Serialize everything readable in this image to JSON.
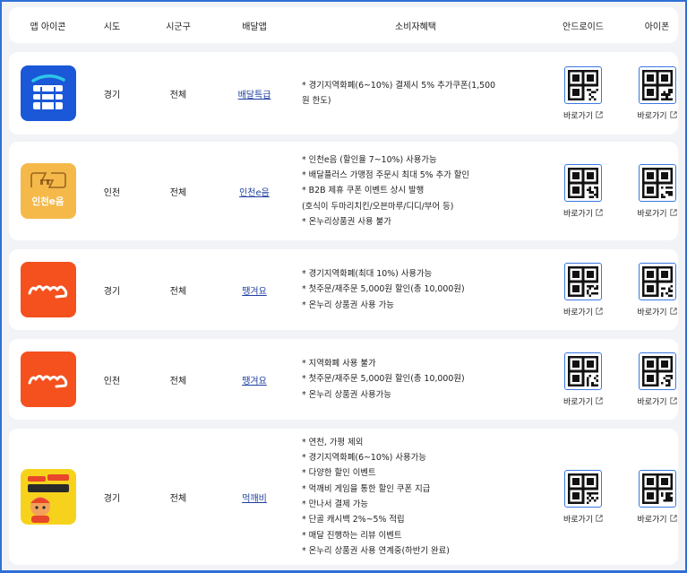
{
  "header": {
    "col_icon": "앱 아이콘",
    "col_sido": "시도",
    "col_sigungu": "시군구",
    "col_app": "배달앱",
    "col_benefit": "소비자혜택",
    "col_android": "안드로이드",
    "col_iphone": "아이폰"
  },
  "colors": {
    "accent": "#2f6fd6",
    "link": "#1f3f9f"
  },
  "rows": [
    {
      "icon": "baedal-teukgeup-app-icon",
      "sido": "경기",
      "sigungu": "전체",
      "app": "배달특급",
      "benefits": [
        "* 경기지역화폐(6~10%) 결제시 5% 추가쿠폰(1,500",
        "원 한도)"
      ],
      "android": "바로가기",
      "iphone": "바로가기"
    },
    {
      "icon": "incheon-eum-app-icon",
      "icon_text": "인천e음",
      "sido": "인천",
      "sigungu": "전체",
      "app": "인천e음",
      "benefits": [
        "* 인천e음 (할인율 7~10%) 사용가능",
        "* 배달플러스 가맹점 주문시 최대 5% 추가 할인",
        "* B2B 제휴 쿠폰 이벤트 상시 발행",
        "(호식이 두마리치킨/오븐마루/디디/부어 등)",
        "* 온누리상품권 사용 불가"
      ],
      "android": "바로가기",
      "iphone": "바로가기"
    },
    {
      "icon": "ttaenggyeoyo-app-icon",
      "sido": "경기",
      "sigungu": "전체",
      "app": "땡겨요",
      "benefits": [
        "* 경기지역화폐(최대 10%) 사용가능",
        "* 첫주문/재주문 5,000원 할인(총 10,000원)",
        "* 온누리 상품권 사용 가능"
      ],
      "android": "바로가기",
      "iphone": "바로가기"
    },
    {
      "icon": "ttaenggyeoyo-app-icon",
      "sido": "인천",
      "sigungu": "전체",
      "app": "땡겨요",
      "benefits": [
        "* 지역화폐 사용 불가",
        "* 첫주문/재주문 5,000원 할인(총 10,000원)",
        "* 온누리 상품권 사용가능"
      ],
      "android": "바로가기",
      "iphone": "바로가기"
    },
    {
      "icon": "meokkaebi-app-icon",
      "sido": "경기",
      "sigungu": "전체",
      "app": "먹깨비",
      "benefits": [
        "* 연천, 가평 제외",
        "* 경기지역화폐(6~10%) 사용가능",
        "* 다양한 할인 이벤트",
        "* 먹깨비 게임을 통한 할인 쿠폰 지급",
        "* 만나서 결제 가능",
        "* 단골 캐시백 2%~5% 적립",
        "* 매달 진행하는 리뷰 이벤트",
        "* 온누리 상품권 사용 연계중(하반기 완료)"
      ],
      "android": "바로가기",
      "iphone": "바로가기"
    }
  ]
}
